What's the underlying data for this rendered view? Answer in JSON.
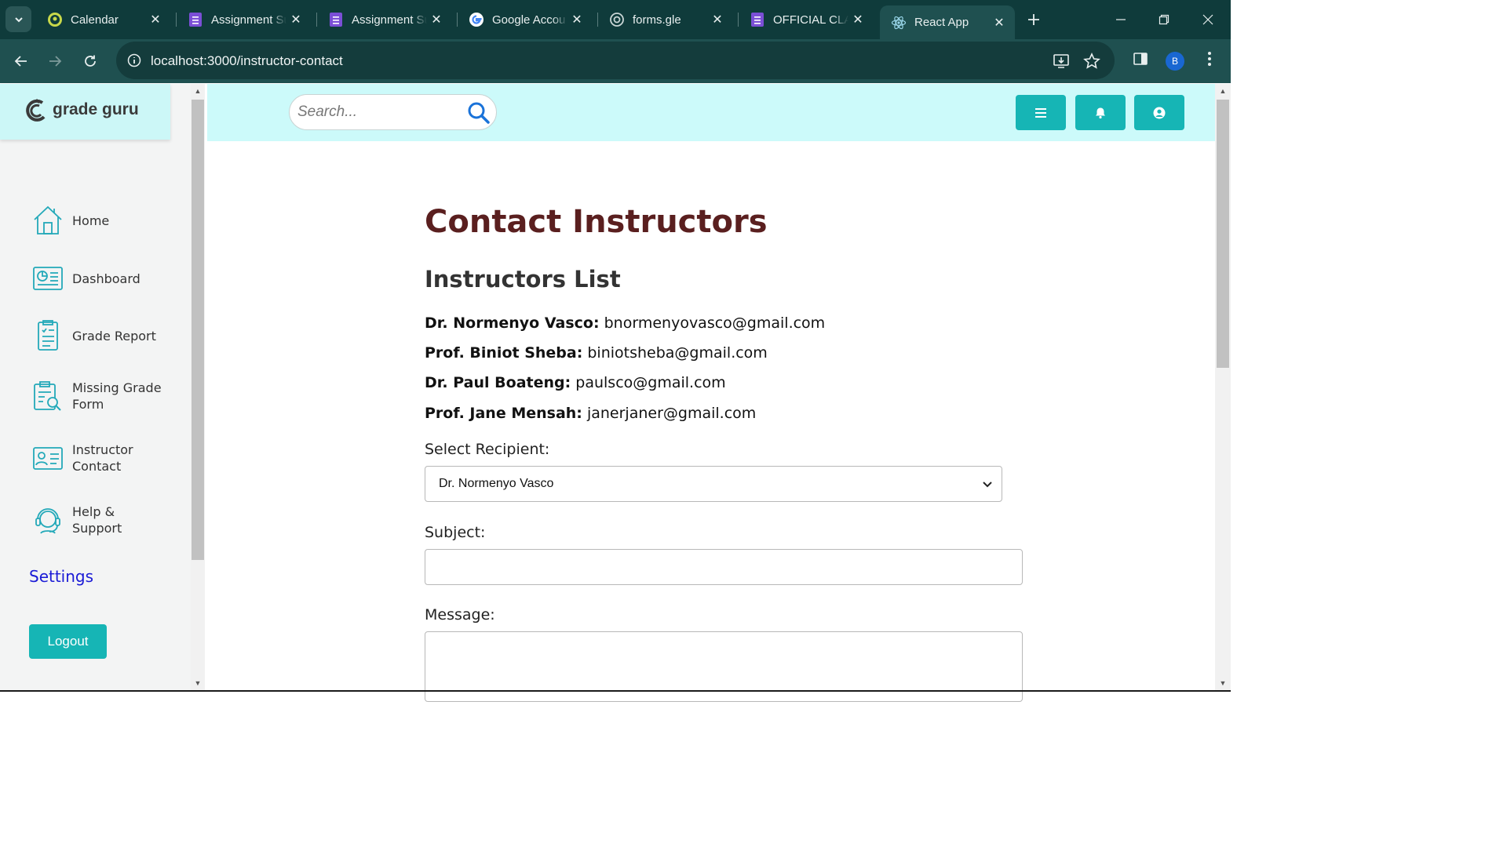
{
  "browser": {
    "tabs": [
      {
        "title": "Calendar",
        "icon": "calendar-favicon"
      },
      {
        "title": "Assignment Su",
        "icon": "forms-favicon"
      },
      {
        "title": "Assignment Su",
        "icon": "forms-favicon"
      },
      {
        "title": "Google Accou",
        "icon": "google-favicon"
      },
      {
        "title": "forms.gle",
        "icon": "globe-favicon"
      },
      {
        "title": "OFFICIAL CLA",
        "icon": "forms-favicon"
      },
      {
        "title": "React App",
        "icon": "react-favicon"
      }
    ],
    "active_tab_index": 6,
    "url": "localhost:3000/instructor-contact",
    "profile_initial": "B"
  },
  "app": {
    "brand": "grade guru",
    "search": {
      "placeholder": "Search..."
    },
    "sidebar": {
      "items": [
        {
          "label": "Home",
          "icon": "home-icon"
        },
        {
          "label": "Dashboard",
          "icon": "dashboard-icon"
        },
        {
          "label": "Grade Report",
          "icon": "grade-report-icon"
        },
        {
          "label": "Missing Grade Form",
          "icon": "missing-grade-icon"
        },
        {
          "label": "Instructor Contact",
          "icon": "contact-card-icon"
        },
        {
          "label": "Help & Support",
          "icon": "support-headset-icon"
        }
      ],
      "settings": "Settings",
      "logout": "Logout"
    }
  },
  "content": {
    "title": "Contact Instructors",
    "list_title": "Instructors List",
    "instructors": [
      {
        "name": "Dr. Normenyo Vasco:",
        "email": "bnormenyovasco@gmail.com"
      },
      {
        "name": "Prof. Biniot Sheba:",
        "email": "biniotsheba@gmail.com"
      },
      {
        "name": "Dr. Paul Boateng:",
        "email": "paulsco@gmail.com"
      },
      {
        "name": "Prof. Jane Mensah:",
        "email": "janerjaner@gmail.com"
      }
    ],
    "form": {
      "recipient_label": "Select Recipient:",
      "recipient_value": "Dr. Normenyo Vasco",
      "subject_label": "Subject:",
      "subject_value": "",
      "message_label": "Message:",
      "message_value": ""
    }
  },
  "colors": {
    "accent": "#16b5b5",
    "header_bg": "#ccfafa",
    "title": "#5a1f1f",
    "link": "#1a1ad6"
  }
}
